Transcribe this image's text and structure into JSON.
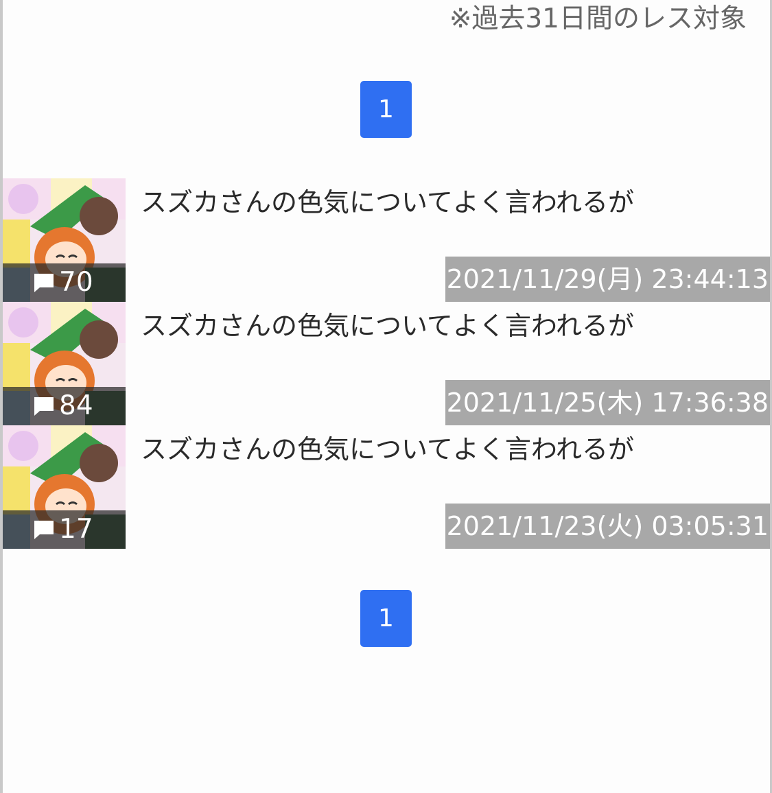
{
  "header": {
    "note": "※過去31日間のレス対象"
  },
  "pagination": {
    "top_page": "1",
    "bottom_page": "1"
  },
  "threads": [
    {
      "title": "スズカさんの色気についてよく言われるが",
      "count": "70",
      "date": "2021/11/29(月) 23:44:13"
    },
    {
      "title": "スズカさんの色気についてよく言われるが",
      "count": "84",
      "date": "2021/11/25(木) 17:36:38"
    },
    {
      "title": "スズカさんの色気についてよく言われるが",
      "count": "17",
      "date": "2021/11/23(火) 03:05:31"
    }
  ],
  "colors": {
    "pager_bg": "#2f6ff2",
    "date_bg": "#a8a8a8",
    "badge_bg": "rgba(40,40,40,0.72)"
  },
  "icons": {
    "comment": "comment-icon"
  }
}
